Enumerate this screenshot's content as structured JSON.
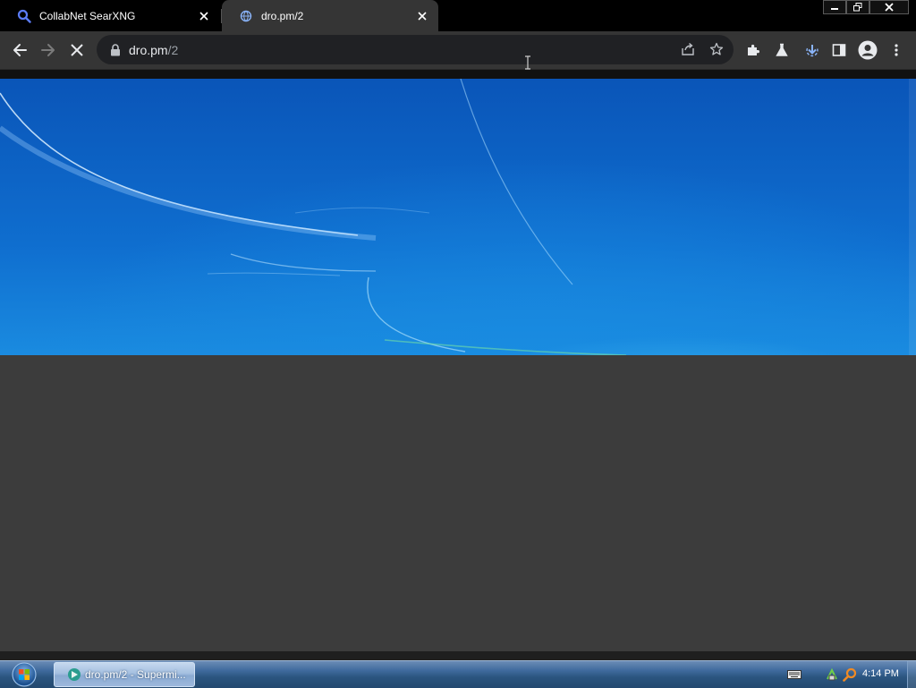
{
  "browser": {
    "tabs": [
      {
        "title": "CollabNet SearXNG",
        "active": false,
        "favicon": "search-icon"
      },
      {
        "title": "dro.pm/2",
        "active": true,
        "loading": true,
        "favicon": "globe-loading-icon"
      }
    ],
    "address_bar": {
      "host": "dro.pm",
      "path": "/2"
    },
    "toolbar_icons": [
      "back-arrow-icon",
      "forward-arrow-icon",
      "stop-loading-icon",
      "lock-icon",
      "share-icon",
      "bookmark-star-icon",
      "extensions-puzzle-icon",
      "labs-flask-icon",
      "download-icon",
      "side-panel-icon",
      "profile-icon",
      "menu-icon"
    ]
  },
  "page": {
    "banner": "blue wallpaper with light streaks",
    "body_color": "#3c3c3c"
  },
  "taskbar": {
    "task_button_label": "dro.pm/2 - Supermi...",
    "clock": "4:14 PM",
    "tray_icons": [
      "keyboard-icon",
      "network-icon",
      "search-tray-icon"
    ]
  },
  "colors": {
    "tabstrip": "#000000",
    "toolbar": "#353535",
    "omnibox": "#202124",
    "accent_blue": "#1a73e8"
  }
}
